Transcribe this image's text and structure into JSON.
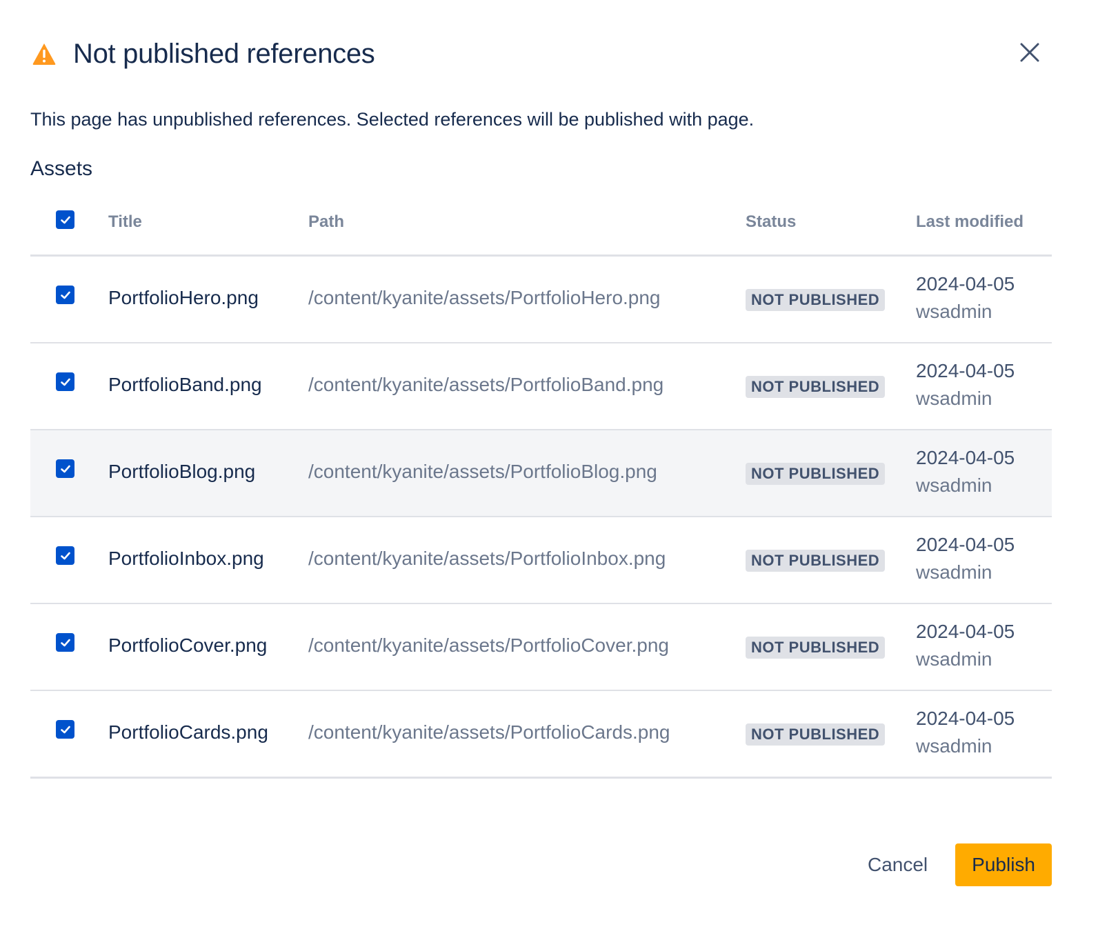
{
  "dialog": {
    "title": "Not published references",
    "description": "This page has unpublished references. Selected references will be published with page.",
    "section_title": "Assets"
  },
  "table": {
    "headers": {
      "title": "Title",
      "path": "Path",
      "status": "Status",
      "last_modified": "Last modified"
    },
    "select_all_checked": true,
    "rows": [
      {
        "title": "PortfolioHero.png",
        "path": "/content/kyanite/assets/PortfolioHero.png",
        "status": "NOT PUBLISHED",
        "date": "2024-04-05",
        "user": "wsadmin",
        "checked": true
      },
      {
        "title": "PortfolioBand.png",
        "path": "/content/kyanite/assets/PortfolioBand.png",
        "status": "NOT PUBLISHED",
        "date": "2024-04-05",
        "user": "wsadmin",
        "checked": true
      },
      {
        "title": "PortfolioBlog.png",
        "path": "/content/kyanite/assets/PortfolioBlog.png",
        "status": "NOT PUBLISHED",
        "date": "2024-04-05",
        "user": "wsadmin",
        "checked": true
      },
      {
        "title": "PortfolioInbox.png",
        "path": "/content/kyanite/assets/PortfolioInbox.png",
        "status": "NOT PUBLISHED",
        "date": "2024-04-05",
        "user": "wsadmin",
        "checked": true
      },
      {
        "title": "PortfolioCover.png",
        "path": "/content/kyanite/assets/PortfolioCover.png",
        "status": "NOT PUBLISHED",
        "date": "2024-04-05",
        "user": "wsadmin",
        "checked": true
      },
      {
        "title": "PortfolioCards.png",
        "path": "/content/kyanite/assets/PortfolioCards.png",
        "status": "NOT PUBLISHED",
        "date": "2024-04-05",
        "user": "wsadmin",
        "checked": true
      }
    ]
  },
  "footer": {
    "cancel_label": "Cancel",
    "publish_label": "Publish"
  },
  "colors": {
    "warning": "#ff991f",
    "checkbox": "#0052cc",
    "publish_button": "#ffab00",
    "badge_bg": "#dfe1e6"
  },
  "icons": {
    "warning": "warning-icon",
    "close": "close-icon",
    "check": "check-icon"
  }
}
